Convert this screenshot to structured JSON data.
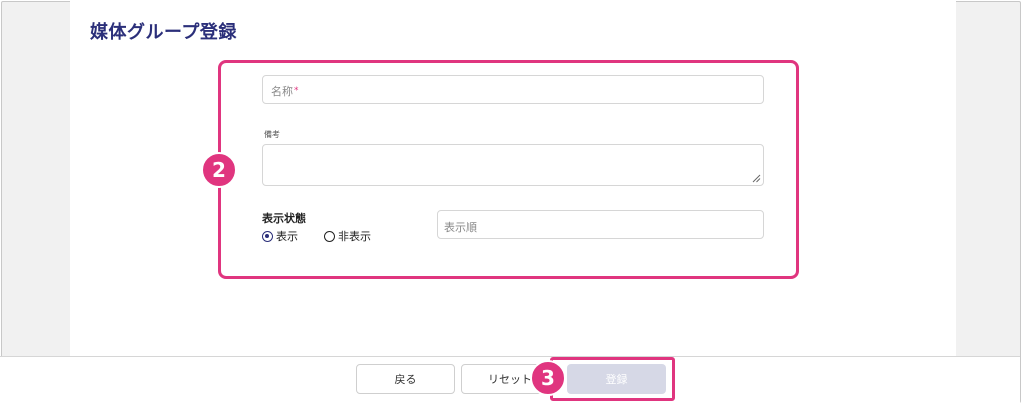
{
  "page": {
    "title": "媒体グループ登録"
  },
  "form": {
    "name": {
      "placeholder": "名称",
      "required_mark": "*"
    },
    "note": {
      "label": "備考"
    },
    "status": {
      "label": "表示状態",
      "options": [
        {
          "label": "表示",
          "selected": true
        },
        {
          "label": "非表示",
          "selected": false
        }
      ]
    },
    "order": {
      "placeholder": "表示順"
    }
  },
  "footer": {
    "back_label": "戻る",
    "reset_label": "リセット",
    "submit_label": "登録"
  },
  "badges": {
    "form": "2",
    "submit": "3"
  },
  "colors": {
    "accent": "#e0357f",
    "title": "#2b2f7a",
    "submit_disabled": "#d6d8e6"
  }
}
